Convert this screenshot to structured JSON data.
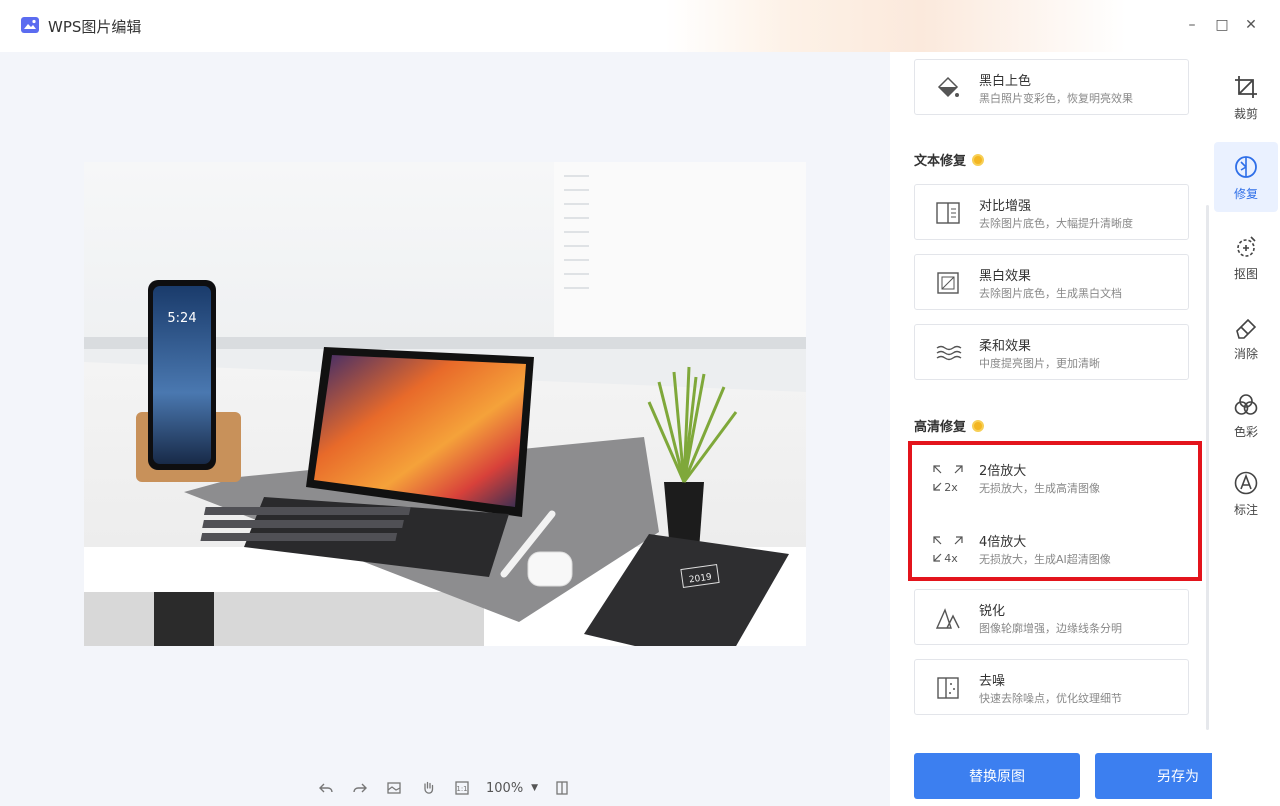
{
  "app": {
    "title": "WPS图片编辑"
  },
  "window": {
    "minimize": "–",
    "maximize": "□",
    "close": "✕"
  },
  "toolbar": {
    "zoom": "100%"
  },
  "panel": {
    "top_card": {
      "name": "黑白上色",
      "desc": "黑白照片变彩色，恢复明亮效果",
      "icon": "colorize-icon"
    },
    "text_section": {
      "title": "文本修复",
      "cards": [
        {
          "name": "对比增强",
          "desc": "去除图片底色，大幅提升清晰度",
          "icon": "contrast-icon"
        },
        {
          "name": "黑白效果",
          "desc": "去除图片底色，生成黑白文档",
          "icon": "bw-icon"
        },
        {
          "name": "柔和效果",
          "desc": "中度提亮图片，更加清晰",
          "icon": "soft-icon"
        }
      ]
    },
    "hd_section": {
      "title": "高清修复",
      "cards": [
        {
          "name": "2倍放大",
          "desc": "无损放大，生成高清图像",
          "badge": "2x",
          "icon": "upscale-2x-icon"
        },
        {
          "name": "4倍放大",
          "desc": "无损放大，生成AI超清图像",
          "badge": "4x",
          "icon": "upscale-4x-icon"
        },
        {
          "name": "锐化",
          "desc": "图像轮廓增强，边缘线条分明",
          "icon": "sharpen-icon"
        },
        {
          "name": "去噪",
          "desc": "快速去除噪点，优化纹理细节",
          "icon": "denoise-icon"
        }
      ]
    },
    "buttons": {
      "replace": "替换原图",
      "save_as": "另存为"
    }
  },
  "rail": [
    {
      "label": "裁剪",
      "icon": "crop-icon",
      "active": false
    },
    {
      "label": "修复",
      "icon": "repair-icon",
      "active": true
    },
    {
      "label": "抠图",
      "icon": "cutout-icon",
      "active": false
    },
    {
      "label": "消除",
      "icon": "eraser-icon",
      "active": false
    },
    {
      "label": "色彩",
      "icon": "color-icon",
      "active": false
    },
    {
      "label": "标注",
      "icon": "annotate-icon",
      "active": false
    }
  ],
  "photo": {
    "phone_time": "5:24",
    "notebook_label": "2019"
  },
  "colors": {
    "accent": "#3c7ff0",
    "highlight": "#e3141c",
    "vip": "#f3b622"
  }
}
